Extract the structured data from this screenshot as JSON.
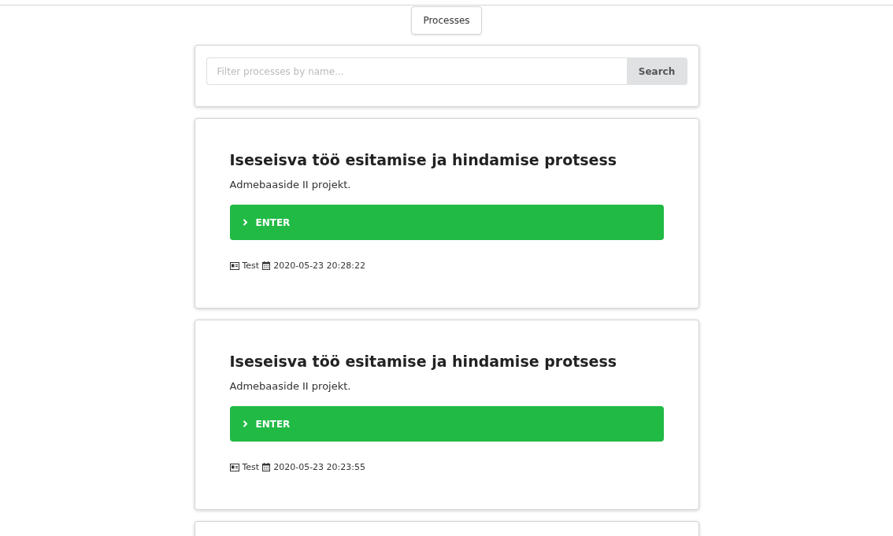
{
  "nav": {
    "tab": "Processes"
  },
  "search": {
    "placeholder": "Filter processes by name...",
    "button": "Search"
  },
  "processes": [
    {
      "title": "Iseseisva töö esitamise ja hindamise protsess",
      "description": "Admebaaside II projekt.",
      "action": "ENTER",
      "author": "Test",
      "date": "2020-05-23 20:28:22"
    },
    {
      "title": "Iseseisva töö esitamise ja hindamise protsess",
      "description": "Admebaaside II projekt.",
      "action": "ENTER",
      "author": "Test",
      "date": "2020-05-23 20:23:55"
    }
  ]
}
